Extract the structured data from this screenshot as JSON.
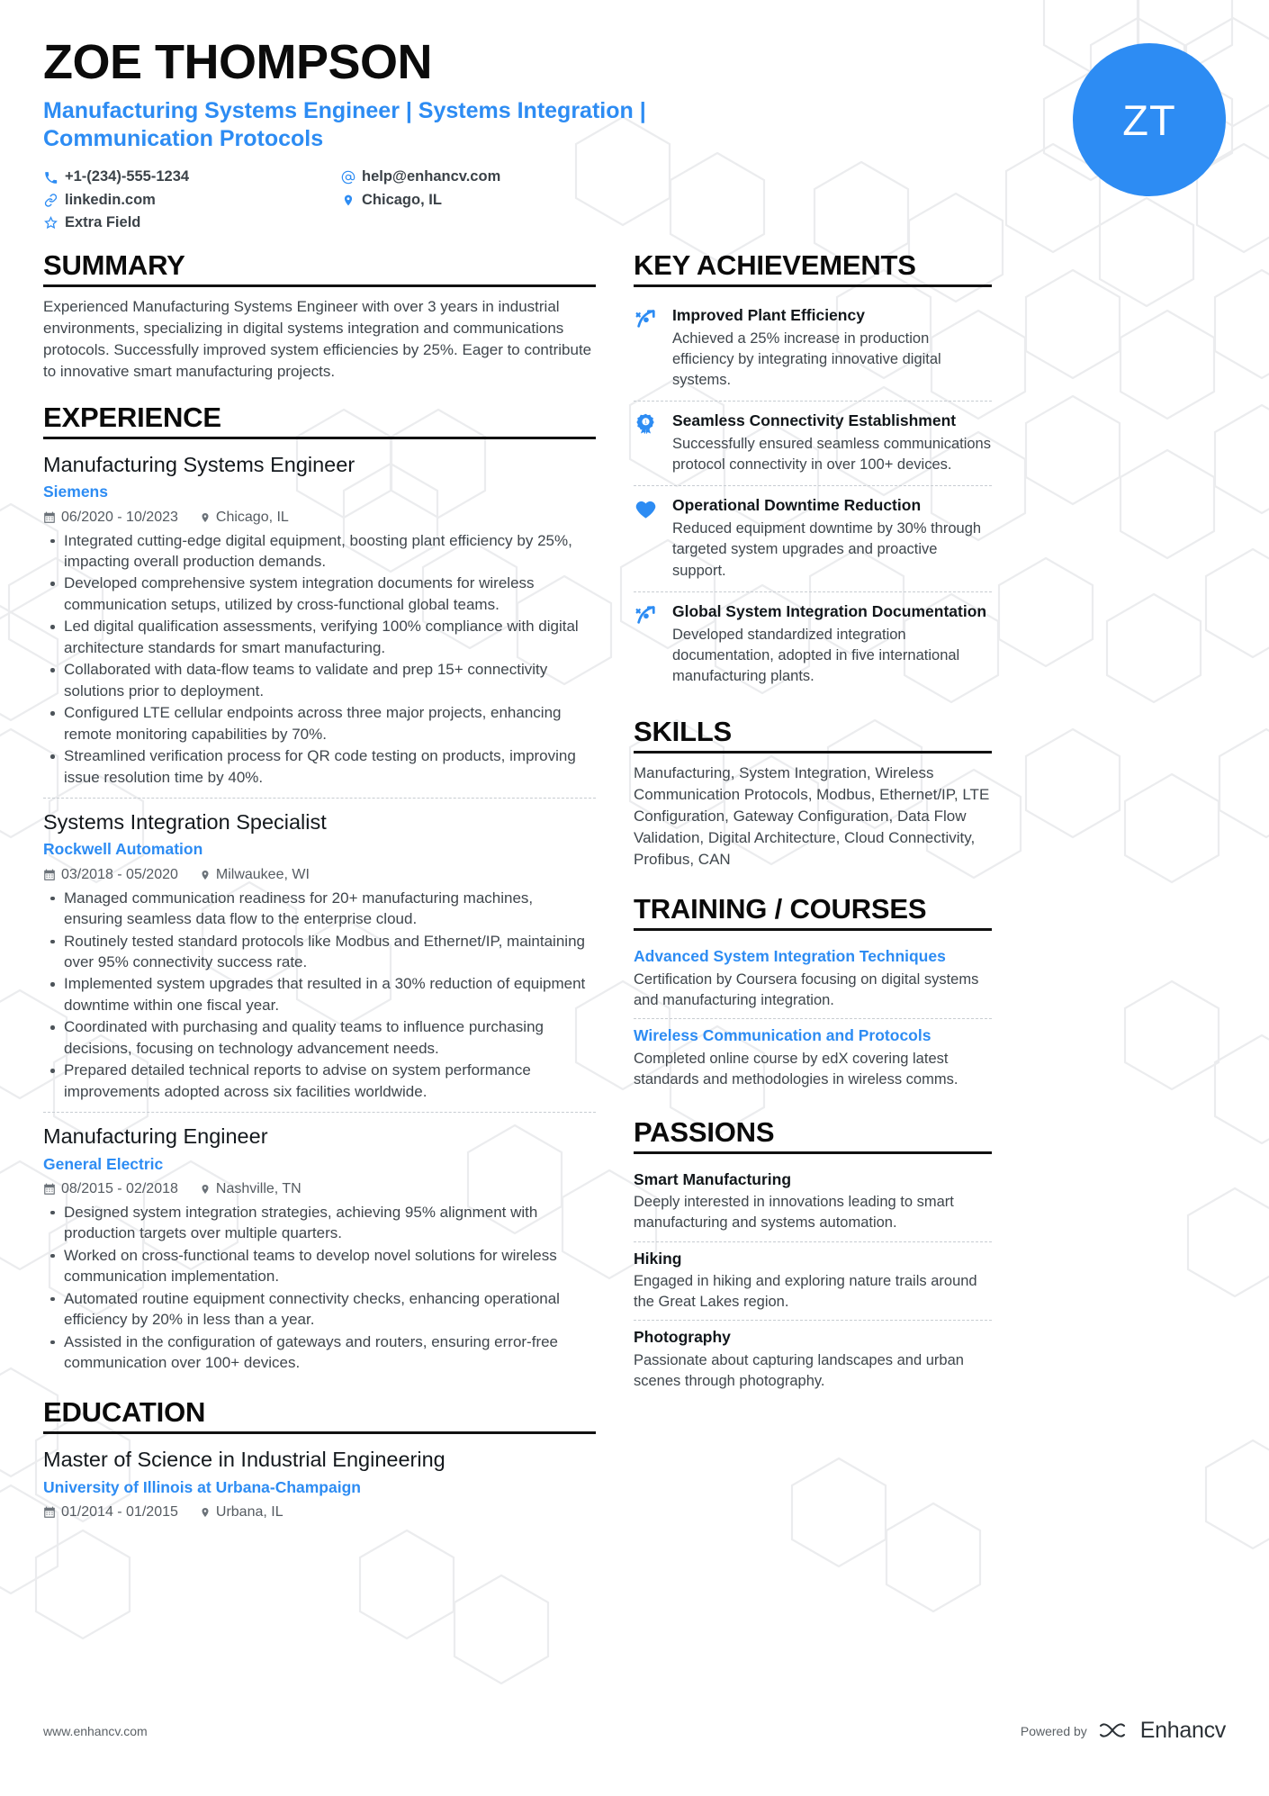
{
  "header": {
    "name": "ZOE THOMPSON",
    "headline": "Manufacturing Systems Engineer | Systems Integration | Communication Protocols",
    "initials": "ZT",
    "contacts": {
      "phone": "+1-(234)-555-1234",
      "linkedin": "linkedin.com",
      "extra": "Extra Field",
      "email": "help@enhancv.com",
      "location": "Chicago, IL"
    }
  },
  "summary": {
    "title": "SUMMARY",
    "text": "Experienced Manufacturing Systems Engineer with over 3 years in industrial environments, specializing in digital systems integration and communications protocols. Successfully improved system efficiencies by 25%. Eager to contribute to innovative smart manufacturing projects."
  },
  "experience": {
    "title": "EXPERIENCE",
    "entries": [
      {
        "role": "Manufacturing Systems Engineer",
        "company": "Siemens",
        "dates": "06/2020 - 10/2023",
        "location": "Chicago, IL",
        "bullets": [
          "Integrated cutting-edge digital equipment, boosting plant efficiency by 25%, impacting overall production demands.",
          "Developed comprehensive system integration documents for wireless communication setups, utilized by cross-functional global teams.",
          "Led digital qualification assessments, verifying 100% compliance with digital architecture standards for smart manufacturing.",
          "Collaborated with data-flow teams to validate and prep 15+ connectivity solutions prior to deployment.",
          "Configured LTE cellular endpoints across three major projects, enhancing remote monitoring capabilities by 70%.",
          "Streamlined verification process for QR code testing on products, improving issue resolution time by 40%."
        ]
      },
      {
        "role": "Systems Integration Specialist",
        "company": "Rockwell Automation",
        "dates": "03/2018 - 05/2020",
        "location": "Milwaukee, WI",
        "bullets": [
          "Managed communication readiness for 20+ manufacturing machines, ensuring seamless data flow to the enterprise cloud.",
          "Routinely tested standard protocols like Modbus and Ethernet/IP, maintaining over 95% connectivity success rate.",
          "Implemented system upgrades that resulted in a 30% reduction of equipment downtime within one fiscal year.",
          "Coordinated with purchasing and quality teams to influence purchasing decisions, focusing on technology advancement needs.",
          "Prepared detailed technical reports to advise on system performance improvements adopted across six facilities worldwide."
        ]
      },
      {
        "role": "Manufacturing Engineer",
        "company": "General Electric",
        "dates": "08/2015 - 02/2018",
        "location": "Nashville, TN",
        "bullets": [
          "Designed system integration strategies, achieving 95% alignment with production targets over multiple quarters.",
          "Worked on cross-functional teams to develop novel solutions for wireless communication implementation.",
          "Automated routine equipment connectivity checks, enhancing operational efficiency by 20% in less than a year.",
          "Assisted in the configuration of gateways and routers, ensuring error-free communication over 100+ devices."
        ]
      }
    ]
  },
  "education": {
    "title": "EDUCATION",
    "entries": [
      {
        "degree": "Master of Science in Industrial Engineering",
        "school": "University of Illinois at Urbana-Champaign",
        "dates": "01/2014 - 01/2015",
        "location": "Urbana, IL"
      }
    ]
  },
  "achievements": {
    "title": "KEY ACHIEVEMENTS",
    "items": [
      {
        "icon": "trending-up-icon",
        "title": "Improved Plant Efficiency",
        "desc": "Achieved a 25% increase in production efficiency by integrating innovative digital systems."
      },
      {
        "icon": "award-ribbon-icon",
        "title": "Seamless Connectivity Establishment",
        "desc": "Successfully ensured seamless communications protocol connectivity in over 100+ devices."
      },
      {
        "icon": "heart-icon",
        "title": "Operational Downtime Reduction",
        "desc": "Reduced equipment downtime by 30% through targeted system upgrades and proactive support."
      },
      {
        "icon": "trending-up-icon",
        "title": "Global System Integration Documentation",
        "desc": "Developed standardized integration documentation, adopted in five international manufacturing plants."
      }
    ]
  },
  "skills": {
    "title": "SKILLS",
    "text": "Manufacturing, System Integration, Wireless Communication Protocols, Modbus, Ethernet/IP, LTE Configuration, Gateway Configuration, Data Flow Validation, Digital Architecture, Cloud Connectivity, Profibus, CAN"
  },
  "training": {
    "title": "TRAINING / COURSES",
    "items": [
      {
        "name": "Advanced System Integration Techniques",
        "desc": "Certification by Coursera focusing on digital systems and manufacturing integration."
      },
      {
        "name": "Wireless Communication and Protocols",
        "desc": "Completed online course by edX covering latest standards and methodologies in wireless comms."
      }
    ]
  },
  "passions": {
    "title": "PASSIONS",
    "items": [
      {
        "name": "Smart Manufacturing",
        "desc": "Deeply interested in innovations leading to smart manufacturing and systems automation."
      },
      {
        "name": "Hiking",
        "desc": "Engaged in hiking and exploring nature trails around the Great Lakes region."
      },
      {
        "name": "Photography",
        "desc": "Passionate about capturing landscapes and urban scenes through photography."
      }
    ]
  },
  "footer": {
    "url": "www.enhancv.com",
    "powered_by": "Powered by",
    "brand": "Enhancv"
  },
  "colors": {
    "accent": "#2d8cf3",
    "text": "#3f464c",
    "heading": "#0b0b0b"
  }
}
